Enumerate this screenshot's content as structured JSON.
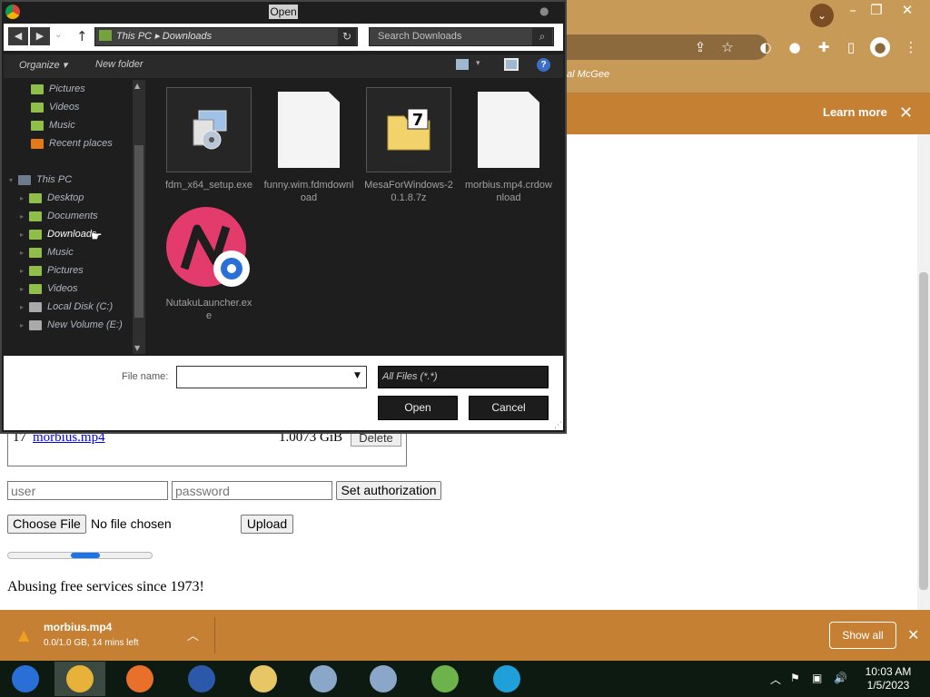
{
  "browser": {
    "bookmark_text": "al McGee",
    "infobar": {
      "learn_more": "Learn more",
      "close_icon": "✕"
    }
  },
  "page": {
    "table_row": {
      "num": "17",
      "filename": "morbius.mp4",
      "size": "1.0073 GiB",
      "delete_label": "Delete"
    },
    "auth": {
      "user_placeholder": "user",
      "password_placeholder": "password",
      "set_label": "Set authorization"
    },
    "upload": {
      "choose_label": "Choose File",
      "no_file": "No file chosen",
      "upload_label": "Upload"
    },
    "progress": {
      "fill_fraction_start": 0.44,
      "fill_fraction_end": 0.64
    },
    "tagline": "Abusing free services since 1973!"
  },
  "download_bar": {
    "file_name": "morbius.mp4",
    "status": "0.0/1.0 GB, 14 mins left",
    "show_all": "Show all",
    "chevron_icon": "︿",
    "close_icon": "✕"
  },
  "taskbar": {
    "time": "10:03 AM",
    "date": "1/5/2023",
    "apps": [
      {
        "name": "desktop-app",
        "color": "#2a6fd8"
      },
      {
        "name": "chrome",
        "color": "#e8b23a",
        "active": true
      },
      {
        "name": "firefox",
        "color": "#e8702a"
      },
      {
        "name": "obama-logo",
        "color": "#2b58a8"
      },
      {
        "name": "file-explorer",
        "color": "#e7c765"
      },
      {
        "name": "setup-exe",
        "color": "#8aa6c8"
      },
      {
        "name": "setup-exe-2",
        "color": "#8aa6c8"
      },
      {
        "name": "network-app",
        "color": "#6db24a"
      },
      {
        "name": "remote-app",
        "color": "#1fa0d8"
      }
    ]
  },
  "dialog": {
    "title": "Open",
    "address": {
      "path": "This PC  ▸  Downloads",
      "search_placeholder": "Search Downloads"
    },
    "toolbar": {
      "organize": "Organize ▾",
      "new_folder": "New folder",
      "help": "?"
    },
    "nav_items": [
      {
        "label": "Pictures",
        "indent": 1,
        "color": "#8fbf4a"
      },
      {
        "label": "Videos",
        "indent": 1,
        "color": "#8fbf4a"
      },
      {
        "label": "Music",
        "indent": 1,
        "color": "#8fbf4a"
      },
      {
        "label": "Recent places",
        "indent": 1,
        "color": "#e07a1a"
      },
      {
        "label": "",
        "indent": 0,
        "color": ""
      },
      {
        "label": "This PC",
        "indent": 0,
        "color": "#6e7b8c"
      },
      {
        "label": "Desktop",
        "indent": 2,
        "color": "#8fbf4a"
      },
      {
        "label": "Documents",
        "indent": 2,
        "color": "#8fbf4a"
      },
      {
        "label": "Downloads",
        "indent": 2,
        "color": "#8fbf4a",
        "selected": true
      },
      {
        "label": "Music",
        "indent": 2,
        "color": "#8fbf4a"
      },
      {
        "label": "Pictures",
        "indent": 2,
        "color": "#8fbf4a"
      },
      {
        "label": "Videos",
        "indent": 2,
        "color": "#8fbf4a"
      },
      {
        "label": "Local Disk (C:)",
        "indent": 2,
        "color": "#aaaaaa"
      },
      {
        "label": "New Volume (E:)",
        "indent": 2,
        "color": "#aaaaaa"
      }
    ],
    "files": [
      {
        "label": "fdm_x64_setup.exe",
        "icon": "installer-icon"
      },
      {
        "label": "funny.wim.fdmdownload",
        "icon": "blank-file-icon"
      },
      {
        "label": "MesaForWindows-20.1.8.7z",
        "icon": "7zip-archive-icon"
      },
      {
        "label": "morbius.mp4.crdownload",
        "icon": "blank-file-icon"
      },
      {
        "label": "NutakuLauncher.exe",
        "icon": "nutaku-icon"
      }
    ],
    "file_name_label": "File name:",
    "file_name_value": "",
    "filter": "All Files (*.*)",
    "open_label": "Open",
    "cancel_label": "Cancel"
  }
}
